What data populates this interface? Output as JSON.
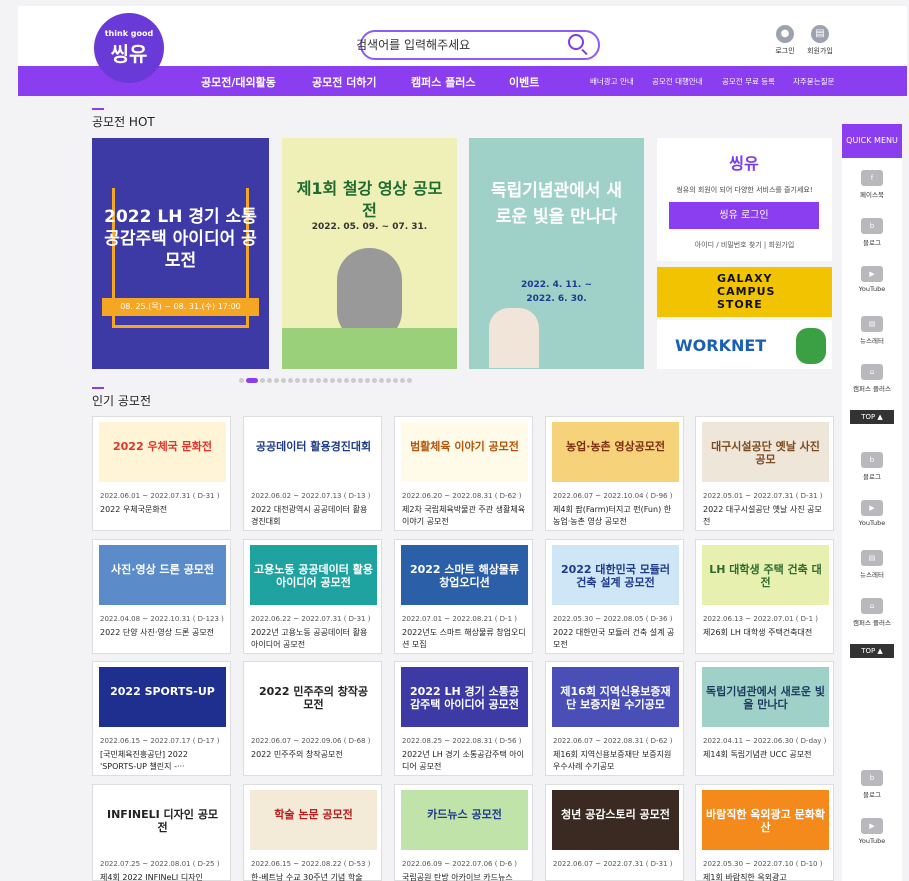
{
  "header": {
    "logo": "씽유",
    "logo_sub": "think good",
    "search_placeholder": "검색어를 입력해주세요",
    "login": "로그인",
    "join": "회원가입"
  },
  "nav": {
    "main": [
      "공모전/대외활동",
      "공모전 더하기",
      "캠퍼스 플러스",
      "이벤트"
    ],
    "sub": [
      "배너광고 안내",
      "공모전 대행안내",
      "공모전 무료 등록",
      "자주묻는질문"
    ]
  },
  "hot": {
    "title": "공모전 HOT",
    "banners": [
      "2022 LH 경기 소통공감주택 아이디어 공모전",
      "제1회 철강 영상 공모전",
      "독립기념관에서 새로운 빛을 만나다"
    ],
    "banner_dates": [
      "08. 25.(목) ~ 08. 31.(수) 17:00",
      "2022. 05. 09. ~ 07. 31.",
      "2022. 4. 11. ~ 2022. 6. 30."
    ]
  },
  "login_box": {
    "desc": "씽유의 회원이 되어 다양한 서비스를 즐기세요!",
    "button": "씽유 로그인",
    "links": "아이디 / 비밀번호 찾기 | 회원가입"
  },
  "ads": {
    "galaxy": "GALAXY CAMPUS STORE",
    "worknet": "WORKNET"
  },
  "popular": {
    "title": "인기 공모전"
  },
  "cards": [
    {
      "thumb": "2022 우체국 문화전",
      "date": "2022.06.01 ~ 2022.07.31 ( D-31 )",
      "title": "2022 우체국문화전",
      "bg": "#fff4d6",
      "fg": "#e0342a"
    },
    {
      "thumb": "공공데이터 활용경진대회",
      "date": "2022.06.02 ~ 2022.07.13 ( D-13 )",
      "title": "2022 대전광역시 공공데이터 활용 경진대회",
      "bg": "#ffffff",
      "fg": "#1f3a8a"
    },
    {
      "thumb": "범활체육 이야기 공모전",
      "date": "2022.06.20 ~ 2022.08.31 ( D-62 )",
      "title": "제2차 국립체육박물관 주관 생활체육 이야기 공모전",
      "bg": "#fffbe8",
      "fg": "#b45309"
    },
    {
      "thumb": "농업·농촌 영상공모전",
      "date": "2022.06.07 ~ 2022.10.04 ( D-96 )",
      "title": "제4회 팜(Farm)터지고 펀(Fun) 한 농업·농촌 영상 공모전",
      "bg": "#f6d27a",
      "fg": "#7c2d12"
    },
    {
      "thumb": "대구시설공단 옛날 사진 공모",
      "date": "2022.05.01 ~ 2022.07.31 ( D-31 )",
      "title": "2022 대구시설공단 옛날 사진 공모전",
      "bg": "#efe6da",
      "fg": "#7c4a1e"
    },
    {
      "thumb": "사진·영상 드론 공모전",
      "date": "2022.04.08 ~ 2022.10.31 ( D-123 )",
      "title": "2022 단양 사진·영상 드론 공모전",
      "bg": "#5b8bc9",
      "fg": "#ffffff"
    },
    {
      "thumb": "고용노동 공공데이터 활용 아이디어 공모전",
      "date": "2022.06.22 ~ 2022.07.31 ( D-31 )",
      "title": "2022년 고용노동 공공데이터 활용 아이디어 공모전",
      "bg": "#1fa3a0",
      "fg": "#ffffff"
    },
    {
      "thumb": "2022 스마트 해상물류 창업오디션",
      "date": "2022.07.01 ~ 2022.08.21 ( D-1 )",
      "title": "2022년도 스마트 해상물류 창업오디션 모집",
      "bg": "#2b5fa8",
      "fg": "#ffffff"
    },
    {
      "thumb": "2022 대한민국 모듈러 건축 설계 공모전",
      "date": "2022.05.30 ~ 2022.08.05 ( D-36 )",
      "title": "2022 대한민국 모듈러 건축 설계 공모전",
      "bg": "#cfe6f7",
      "fg": "#1e3a8a"
    },
    {
      "thumb": "LH 대학생 주택 건축 대전",
      "date": "2022.06.13 ~ 2022.07.01 ( D-1 )",
      "title": "제26회 LH 대학생 주택건축대전",
      "bg": "#e8f0b0",
      "fg": "#2f6b2f"
    },
    {
      "thumb": "2022 SPORTS-UP",
      "date": "2022.06.15 ~ 2022.07.17 ( D-17 )",
      "title": "[국민체육진흥공단] 2022 'SPORTS-UP 챌린지 -···",
      "bg": "#1e2f8f",
      "fg": "#ffffff"
    },
    {
      "thumb": "2022 민주주의 창작공모전",
      "date": "2022.06.07 ~ 2022.09.06 ( D-68 )",
      "title": "2022 민주주의 창작공모전",
      "bg": "#ffffff",
      "fg": "#222222"
    },
    {
      "thumb": "2022 LH 경기 소통공감주택 아이디어 공모전",
      "date": "2022.08.25 ~ 2022.08.31 ( D-56 )",
      "title": "2022년 LH 경기 소통공감주택 아이디어 공모전",
      "bg": "#3d3aa6",
      "fg": "#ffffff"
    },
    {
      "thumb": "제16회 지역신용보증재단 보증지원 수기공모",
      "date": "2022.06.07 ~ 2022.08.31 ( D-62 )",
      "title": "제16회 지역신용보증재단 보증지원 우수사례 수기공모",
      "bg": "#4a4fb8",
      "fg": "#ffffff"
    },
    {
      "thumb": "독립기념관에서 새로운 빛을 만나다",
      "date": "2022.04.11 ~ 2022.06.30 ( D-day )",
      "title": "제14회 독립기념관 UCC 공모전",
      "bg": "#9fd1c9",
      "fg": "#1e3a5f"
    },
    {
      "thumb": "INFINELI 디자인 공모전",
      "date": "2022.07.25 ~ 2022.08.01 ( D-25 )",
      "title": "제4회 2022 INFINeLI 디자인",
      "bg": "#ffffff",
      "fg": "#222222"
    },
    {
      "thumb": "학술 논문 공모전",
      "date": "2022.06.15 ~ 2022.08.22 ( D-53 )",
      "title": "한-베트남 수교 30주년 기념 학술",
      "bg": "#f3ead8",
      "fg": "#b91c1c"
    },
    {
      "thumb": "카드뉴스 공모전",
      "date": "2022.06.09 ~ 2022.07.06 ( D-6 )",
      "title": "국립공원 탄방 아카이브 카드뉴스",
      "bg": "#bfe3a8",
      "fg": "#1e3a8a"
    },
    {
      "thumb": "청년 공감스토리 공모전",
      "date": "2022.06.07 ~ 2022.07.31 ( D-31 )",
      "title": "",
      "bg": "#3b2a22",
      "fg": "#ffffff"
    },
    {
      "thumb": "바람직한 옥외광고 문화확산",
      "date": "2022.05.30 ~ 2022.07.10 ( D-10 )",
      "title": "제1회 바람직한 옥외광고",
      "bg": "#f48a1c",
      "fg": "#ffffff"
    }
  ],
  "quick": {
    "title": "QUICK MENU",
    "items": [
      "페이스북",
      "블로그",
      "YouTube",
      "뉴스레터",
      "캠퍼스 플러스"
    ],
    "top": "TOP ▲",
    "items2": [
      "블로그",
      "YouTube",
      "뉴스레터",
      "캠퍼스 플러스"
    ],
    "items3": [
      "블로그",
      "YouTube"
    ]
  }
}
